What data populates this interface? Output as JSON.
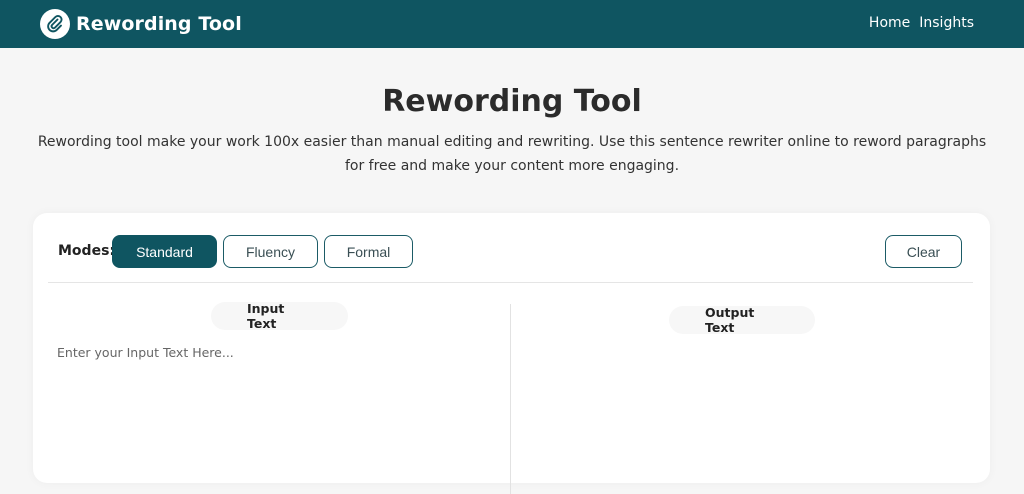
{
  "header": {
    "brand": "Rewording Tool",
    "nav": [
      "Home",
      "Insights"
    ],
    "brand_color": "#0f5561"
  },
  "hero": {
    "title": "Rewording Tool",
    "description": "Rewording tool make your work 100x easier than manual editing and rewriting. Use this sentence rewriter online to reword paragraphs for free and make your content more engaging."
  },
  "tool": {
    "modes_label": "Modes:",
    "modes": [
      "Standard",
      "Fluency",
      "Formal"
    ],
    "selected_mode": "Standard",
    "clear_label": "Clear",
    "input": {
      "label": "Input Text",
      "placeholder": "Enter your Input Text Here...",
      "value": ""
    },
    "output": {
      "label": "Output Text",
      "value": ""
    }
  },
  "icons": {
    "logo": "paperclip-logo-icon"
  }
}
